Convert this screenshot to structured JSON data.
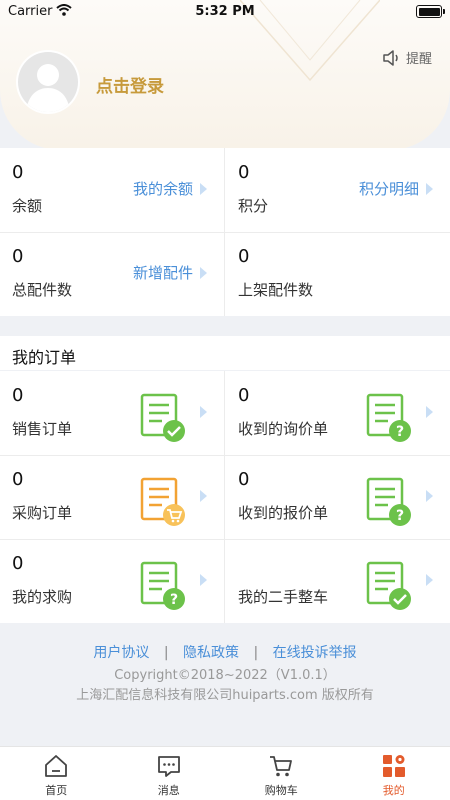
{
  "status_bar": {
    "carrier": "Carrier",
    "time": "5:32 PM"
  },
  "header": {
    "login_text": "点击登录",
    "remind_label": "提醒"
  },
  "account": {
    "balance": {
      "value": "0",
      "label": "余额",
      "link": "我的余额"
    },
    "points": {
      "value": "0",
      "label": "积分",
      "link": "积分明细"
    },
    "total_parts": {
      "value": "0",
      "label": "总配件数",
      "link": "新增配件"
    },
    "listed_parts": {
      "value": "0",
      "label": "上架配件数"
    }
  },
  "orders": {
    "title": "我的订单",
    "items": [
      {
        "value": "0",
        "label": "销售订单",
        "icon": "doc-check-icon"
      },
      {
        "value": "0",
        "label": "收到的询价单",
        "icon": "doc-question-icon"
      },
      {
        "value": "0",
        "label": "采购订单",
        "icon": "doc-cart-icon"
      },
      {
        "value": "0",
        "label": "收到的报价单",
        "icon": "doc-question-icon"
      },
      {
        "value": "0",
        "label": "我的求购",
        "icon": "doc-question-icon"
      },
      {
        "value": "",
        "label": "我的二手整车",
        "icon": "doc-check-icon"
      }
    ]
  },
  "footer": {
    "user_agreement": "用户协议",
    "privacy_policy": "隐私政策",
    "complaint": "在线投诉举报",
    "separator": "|",
    "copyright": "Copyright©2018~2022（V1.0.1）",
    "company": "上海汇配信息科技有限公司huiparts.com 版权所有"
  },
  "tabbar": {
    "home": "首页",
    "messages": "消息",
    "cart": "购物车",
    "mine": "我的"
  },
  "colors": {
    "accent_link": "#4a8fd8",
    "login_gold": "#c79a3b",
    "icon_green": "#6cc24a",
    "icon_orange": "#f2a233",
    "active_tab": "#e35b2c"
  }
}
